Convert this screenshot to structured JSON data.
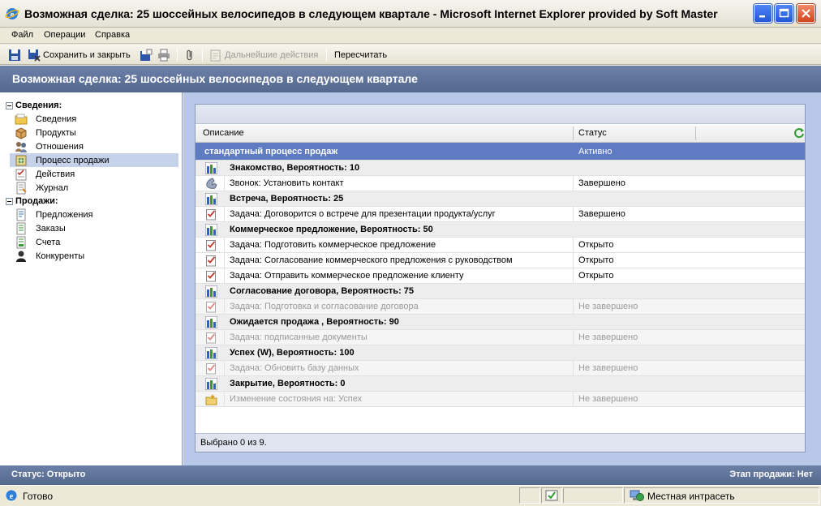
{
  "window": {
    "title": "Возможная сделка: 25 шоссейных велосипедов в следующем квартале - Microsoft Internet Explorer provided by Soft Master"
  },
  "menu": {
    "items": [
      {
        "label": "Файл"
      },
      {
        "label": "Операции"
      },
      {
        "label": "Справка"
      }
    ]
  },
  "toolbar": {
    "save_close_label": "Сохранить и закрыть",
    "further_actions_label": "Дальнейшие действия",
    "recalculate_label": "Пересчитать"
  },
  "header": {
    "title": "Возможная сделка: 25 шоссейных велосипедов в следующем квартале"
  },
  "sidebar": {
    "groups": [
      {
        "label": "Сведения:",
        "items": [
          {
            "label": "Сведения",
            "icon": "folder-icon"
          },
          {
            "label": "Продукты",
            "icon": "product-box-icon"
          },
          {
            "label": "Отношения",
            "icon": "relationships-icon"
          },
          {
            "label": "Процесс продажи",
            "icon": "sales-process-icon",
            "selected": true
          },
          {
            "label": "Действия",
            "icon": "activities-icon"
          },
          {
            "label": "Журнал",
            "icon": "journal-icon"
          }
        ]
      },
      {
        "label": "Продажи:",
        "items": [
          {
            "label": "Предложения",
            "icon": "quote-icon"
          },
          {
            "label": "Заказы",
            "icon": "order-icon"
          },
          {
            "label": "Счета",
            "icon": "invoice-icon"
          },
          {
            "label": "Конкуренты",
            "icon": "competitor-icon"
          }
        ]
      }
    ]
  },
  "grid": {
    "col_description": "Описание",
    "col_status": "Статус",
    "rows": [
      {
        "type": "process",
        "desc": "стандартный процесс продаж",
        "status": "Активно"
      },
      {
        "type": "stage",
        "desc": "Знакомство, Вероятность: 10",
        "status": ""
      },
      {
        "type": "done",
        "icon": "phone-call-icon",
        "desc": "Звонок: Установить контакт",
        "status": "Завершено"
      },
      {
        "type": "stage",
        "desc": "Встреча, Вероятность: 25",
        "status": ""
      },
      {
        "type": "done",
        "icon": "task-icon",
        "desc": "Задача: Договорится о встрече для презентации продукта/услуг",
        "status": "Завершено"
      },
      {
        "type": "stage",
        "desc": "Коммерческое предложение, Вероятность: 50",
        "status": ""
      },
      {
        "type": "open",
        "icon": "task-icon",
        "desc": "Задача: Подготовить коммерческое предложение",
        "status": "Открыто"
      },
      {
        "type": "open",
        "icon": "task-icon",
        "desc": "Задача: Согласование коммерческого предложения с руководством",
        "status": "Открыто"
      },
      {
        "type": "open",
        "icon": "task-icon",
        "desc": "Задача: Отправить коммерческое предложение клиенту",
        "status": "Открыто"
      },
      {
        "type": "stage",
        "desc": "Согласование договора, Вероятность: 75",
        "status": ""
      },
      {
        "type": "muted",
        "icon": "task-icon",
        "desc": "Задача: Подготовка и согласование договора",
        "status": "Не завершено"
      },
      {
        "type": "stage",
        "desc": "Ожидается продажа , Вероятность: 90",
        "status": ""
      },
      {
        "type": "muted",
        "icon": "task-icon",
        "desc": "Задача: подписанные документы",
        "status": "Не завершено"
      },
      {
        "type": "stage",
        "desc": "Успех (W), Вероятность: 100",
        "status": ""
      },
      {
        "type": "muted",
        "icon": "task-icon",
        "desc": "Задача: Обновить базу данных",
        "status": "Не завершено"
      },
      {
        "type": "stage",
        "desc": "Закрытие, Вероятность: 0",
        "status": ""
      },
      {
        "type": "muted",
        "icon": "state-change-icon",
        "desc": "Изменение состояния на: Успех",
        "status": "Не завершено"
      }
    ],
    "footer": "Выбрано 0 из 9."
  },
  "status_strip": {
    "left": "Статус: Открыто",
    "right": "Этап продажи: Нет"
  },
  "ie_status": {
    "ready": "Готово",
    "zone": "Местная интрасеть"
  },
  "colors": {
    "banner": "#5f7396",
    "selected_nav": "#c6d2ea",
    "process_row": "#5f7bc2",
    "main_bg": "#b9c8e8"
  }
}
